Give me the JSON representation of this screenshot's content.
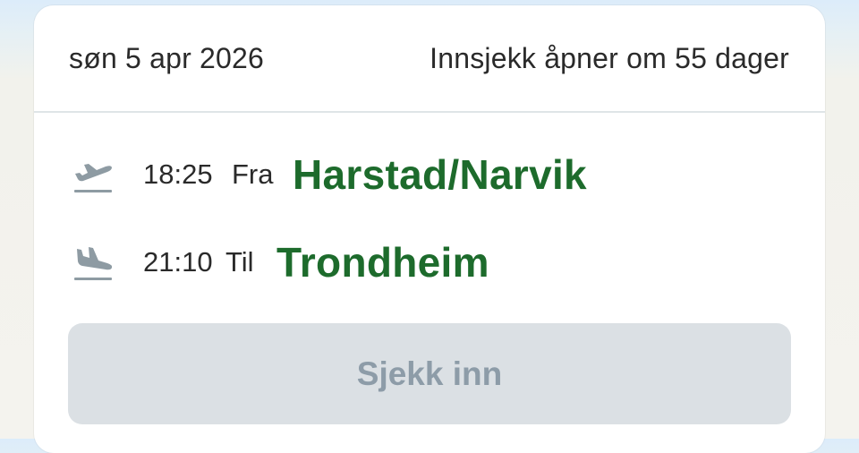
{
  "booking": {
    "date": "søn 5 apr 2026",
    "checkin_info": "Innsjekk åpner om 55 dager"
  },
  "departure": {
    "icon": "airplane-takeoff-icon",
    "time": "18:25",
    "direction_label": "Fra",
    "city": "Harstad/Narvik"
  },
  "arrival": {
    "icon": "airplane-landing-icon",
    "time": "21:10",
    "direction_label": "Til",
    "city": "Trondheim"
  },
  "checkin_button": {
    "label": "Sjekk inn",
    "state": "disabled"
  },
  "colors": {
    "city_text": "#1d6b2c",
    "button_bg": "#dbe0e4",
    "button_text": "#8d9ca8",
    "icon": "#8e9ba3"
  }
}
